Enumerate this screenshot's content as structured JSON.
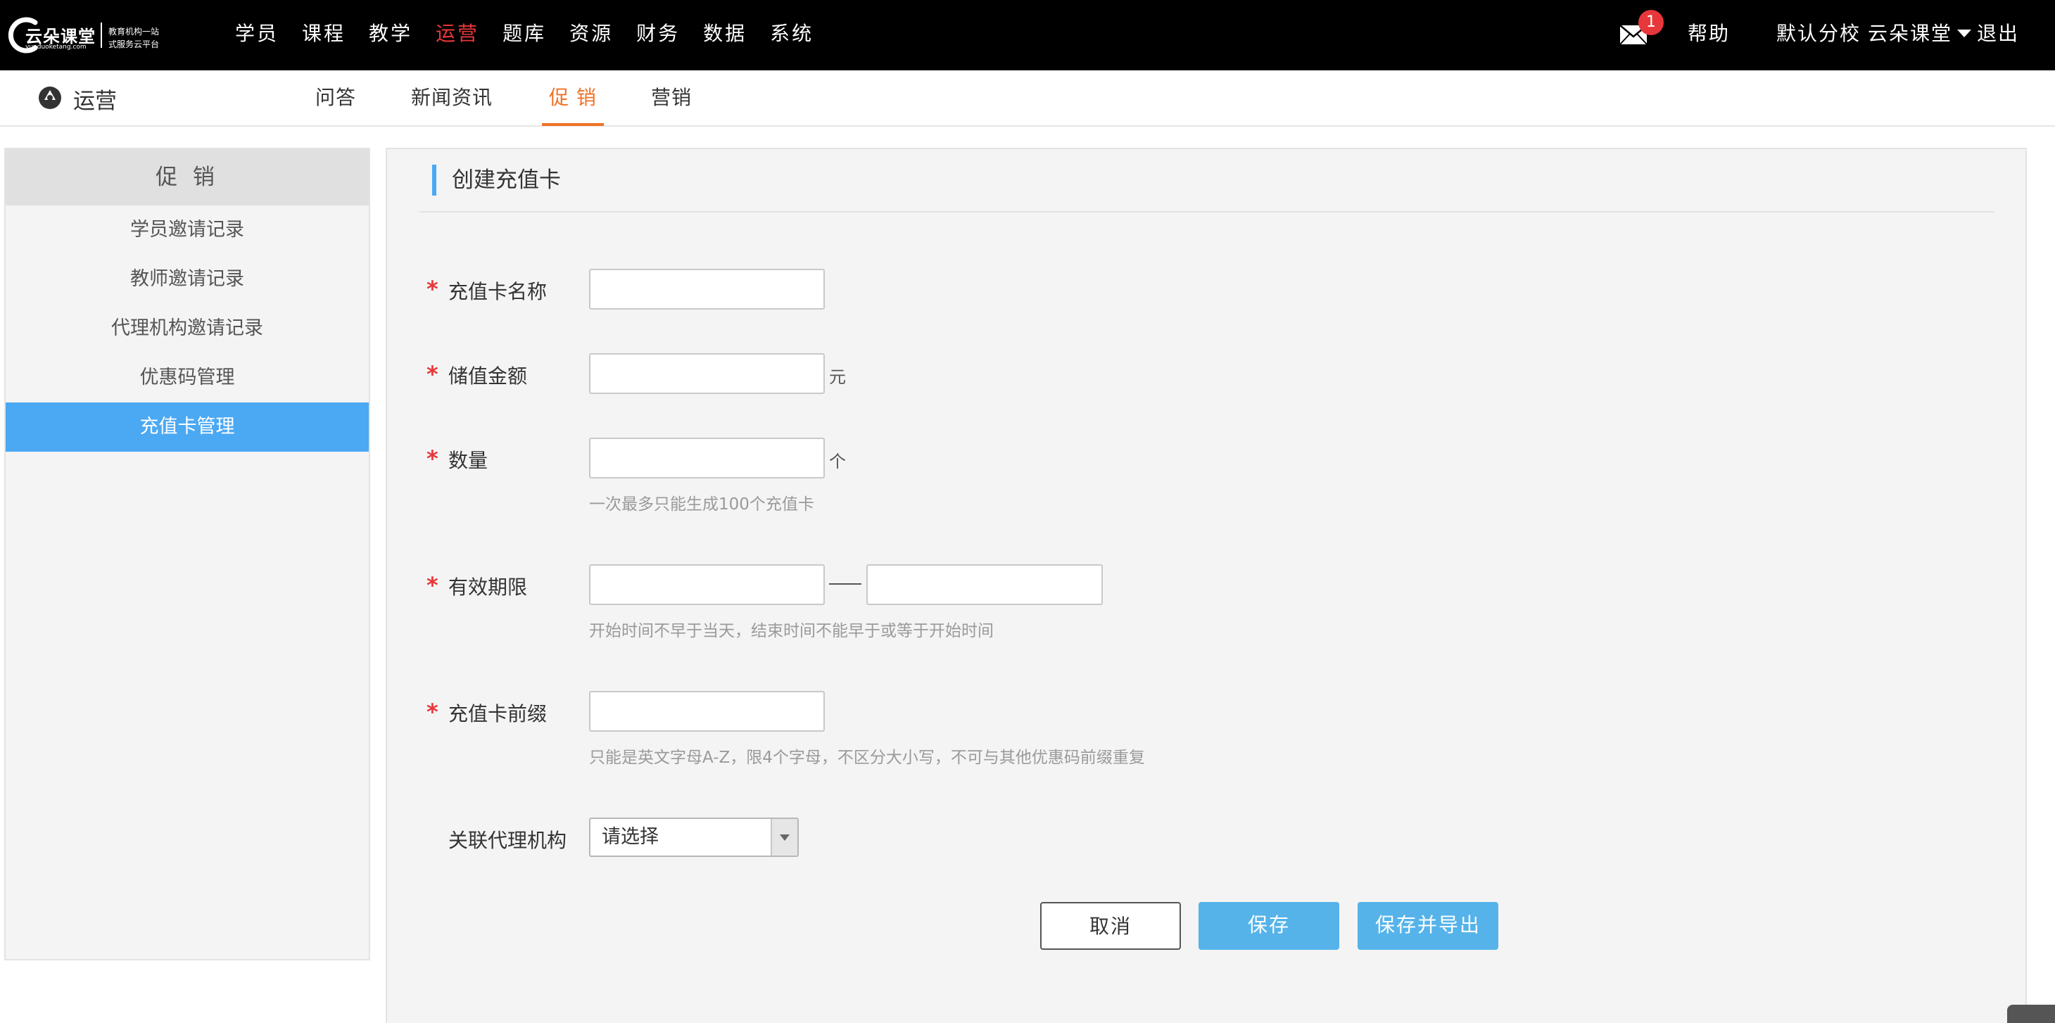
{
  "logo": {
    "brand": "云朵课堂",
    "domain": "yunduoketang.com",
    "tagline_line1": "教育机构一站",
    "tagline_line2": "式服务云平台"
  },
  "main_nav": [
    {
      "label": "学员",
      "active": false
    },
    {
      "label": "课程",
      "active": false
    },
    {
      "label": "教学",
      "active": false
    },
    {
      "label": "运营",
      "active": true
    },
    {
      "label": "题库",
      "active": false
    },
    {
      "label": "资源",
      "active": false
    },
    {
      "label": "财务",
      "active": false
    },
    {
      "label": "数据",
      "active": false
    },
    {
      "label": "系统",
      "active": false
    }
  ],
  "top_right": {
    "mail_icon": "envelope-icon",
    "notification_count": "1",
    "help": "帮助",
    "school": "默认分校",
    "user": "云朵课堂",
    "logout": "退出"
  },
  "sub_header": {
    "section_icon": "operations-icon",
    "section_title": "运营",
    "tabs": [
      {
        "label": "问答",
        "active": false
      },
      {
        "label": "新闻资讯",
        "active": false
      },
      {
        "label": "促 销",
        "active": true
      },
      {
        "label": "营销",
        "active": false
      }
    ]
  },
  "sidebar": {
    "title": "促 销",
    "items": [
      {
        "label": "学员邀请记录",
        "active": false
      },
      {
        "label": "教师邀请记录",
        "active": false
      },
      {
        "label": "代理机构邀请记录",
        "active": false
      },
      {
        "label": "优惠码管理",
        "active": false
      },
      {
        "label": "充值卡管理",
        "active": true
      }
    ]
  },
  "form": {
    "title": "创建充值卡",
    "required_mark": "*",
    "card_name": {
      "label": "充值卡名称",
      "value": "",
      "placeholder": ""
    },
    "amount": {
      "label": "储值金额",
      "value": "",
      "placeholder": "",
      "unit": "元"
    },
    "quantity": {
      "label": "数量",
      "value": "",
      "placeholder": "",
      "unit": "个",
      "hint": "一次最多只能生成100个充值卡"
    },
    "validity": {
      "label": "有效期限",
      "start": "",
      "end": "",
      "hint": "开始时间不早于当天，结束时间不能早于或等于开始时间"
    },
    "prefix": {
      "label": "充值卡前缀",
      "value": "",
      "placeholder": "",
      "hint": "只能是英文字母A-Z，限4个字母，不区分大小写，不可与其他优惠码前缀重复"
    },
    "agency": {
      "label": "关联代理机构",
      "selected": "请选择"
    },
    "buttons": {
      "cancel": "取消",
      "save": "保存",
      "save_export": "保存并导出"
    }
  },
  "colors": {
    "top_bar": "#000000",
    "nav_active": "#e8373a",
    "subtab_active": "#f07226",
    "sidebar_active": "#4ba8f2",
    "primary_button": "#55b3ea",
    "required_star": "#e8373a"
  }
}
